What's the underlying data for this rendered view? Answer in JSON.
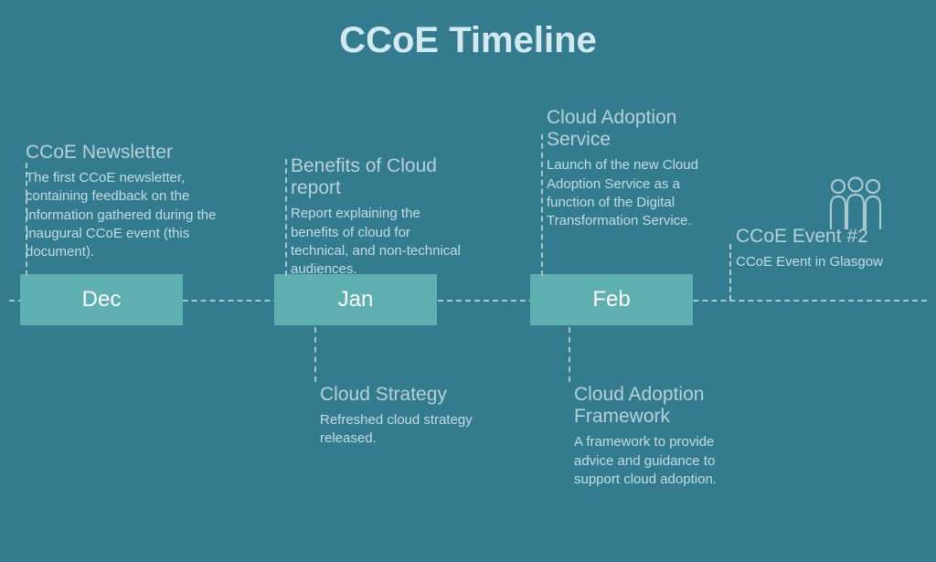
{
  "title": "CCoE Timeline",
  "months": {
    "dec": "Dec",
    "jan": "Jan",
    "feb": "Feb"
  },
  "cards": {
    "newsletter": {
      "title": "CCoE Newsletter",
      "desc": "The first CCoE newsletter, containing feedback on the information gathered during the inaugural CCoE event (this document)."
    },
    "benefits": {
      "title": "Benefits of Cloud report",
      "desc": "Report explaining the benefits of cloud for technical, and non-technical audiences."
    },
    "adoption_service": {
      "title": "Cloud Adoption Service",
      "desc": "Launch of the new Cloud Adoption Service as a function of the Digital Transformation Service."
    },
    "event": {
      "title": "CCoE Event #2",
      "desc": "CCoE Event in Glasgow"
    },
    "strategy": {
      "title": "Cloud Strategy",
      "desc": "Refreshed cloud strategy released."
    },
    "framework": {
      "title": "Cloud Adoption Framework",
      "desc": "A framework to provide advice and guidance to support cloud adoption."
    }
  }
}
